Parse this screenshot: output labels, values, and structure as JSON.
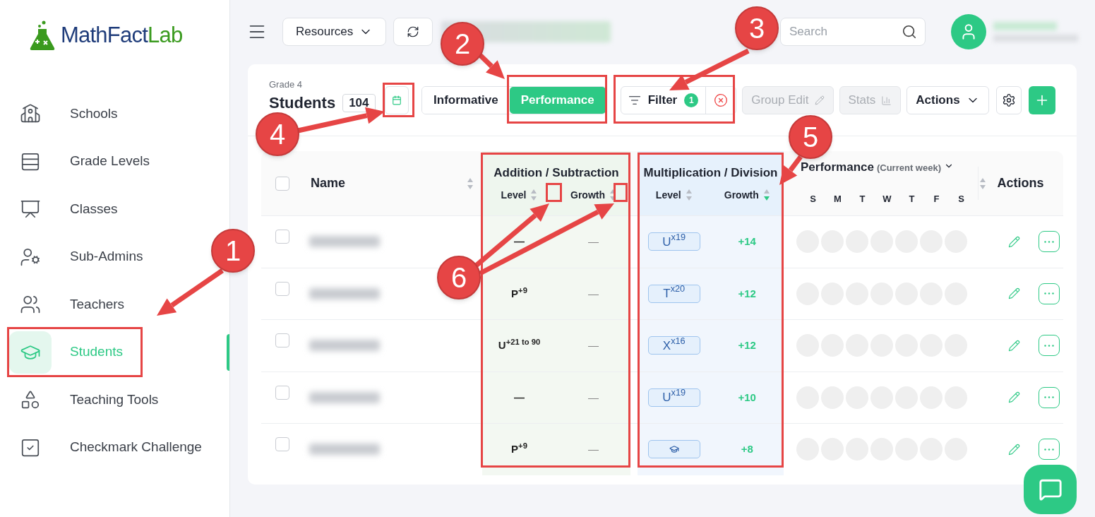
{
  "logo": {
    "first": "MathFact",
    "second": "Lab"
  },
  "sidebar": {
    "items": [
      {
        "label": "Schools",
        "kind": "school",
        "selected": false
      },
      {
        "label": "Grade Levels",
        "kind": "levels",
        "selected": false
      },
      {
        "label": "Classes",
        "kind": "classes",
        "selected": false
      },
      {
        "label": "Sub-Admins",
        "kind": "subadmins",
        "selected": false
      },
      {
        "label": "Teachers",
        "kind": "teachers",
        "selected": false
      },
      {
        "label": "Students",
        "kind": "students",
        "selected": true
      },
      {
        "label": "Teaching Tools",
        "kind": "tools",
        "selected": false
      },
      {
        "label": "Checkmark Challenge",
        "kind": "checkmark",
        "selected": false
      }
    ]
  },
  "topbar": {
    "resources": "Resources",
    "search": {
      "placeholder": "Search"
    }
  },
  "toolbar": {
    "subtitle": "Grade 4",
    "title": "Students",
    "count": "104",
    "view_toggle": [
      {
        "label": "Informative",
        "selected": false
      },
      {
        "label": "Performance",
        "selected": true
      }
    ],
    "filter": {
      "label": "Filter",
      "count": "1"
    },
    "buttons": [
      {
        "label": "Group Edit",
        "kind": "edit",
        "disabled": true
      },
      {
        "label": "Stats",
        "kind": "stats",
        "disabled": true
      },
      {
        "label": "Actions",
        "kind": "dropdown",
        "disabled": false
      }
    ]
  },
  "table": {
    "select_all": {
      "checked": false
    },
    "name_header": "Name",
    "groups": [
      {
        "title": "Addition / Subtraction",
        "columns": [
          {
            "label": "Level",
            "sorted": false
          },
          {
            "label": "Growth",
            "sorted": false
          }
        ]
      },
      {
        "title": "Multiplication / Division",
        "columns": [
          {
            "label": "Level",
            "sorted": false
          },
          {
            "label": "Growth",
            "sorted": true
          }
        ]
      }
    ],
    "performance": {
      "title": "Performance",
      "period": "(Current week)",
      "days": [
        "S",
        "M",
        "T",
        "W",
        "T",
        "F",
        "S"
      ]
    },
    "actions_header": "Actions",
    "rows": [
      {
        "checked": false,
        "add_level": "—",
        "add_growth": "—",
        "mul_level": {
          "kind": "text",
          "text": "U$^{x19}$"
        },
        "mul_growth": "+14"
      },
      {
        "checked": false,
        "add_level": "P$^{+9}$",
        "add_growth": "—",
        "mul_level": {
          "kind": "text",
          "text": "T$^{x20}$"
        },
        "mul_growth": "+12"
      },
      {
        "checked": false,
        "add_level": "U$^{+21 to 90}$",
        "add_growth": "—",
        "mul_level": {
          "kind": "text",
          "text": "X$^{x16}$"
        },
        "mul_growth": "+12"
      },
      {
        "checked": false,
        "add_level": "—",
        "add_growth": "—",
        "mul_level": {
          "kind": "text",
          "text": "U$^{x19}$"
        },
        "mul_growth": "+10"
      },
      {
        "checked": false,
        "add_level": "P$^{+9}$",
        "add_growth": "—",
        "mul_level": {
          "kind": "icon"
        },
        "mul_growth": "+8"
      }
    ]
  },
  "callouts": [
    "1",
    "2",
    "3",
    "4",
    "5",
    "6"
  ]
}
